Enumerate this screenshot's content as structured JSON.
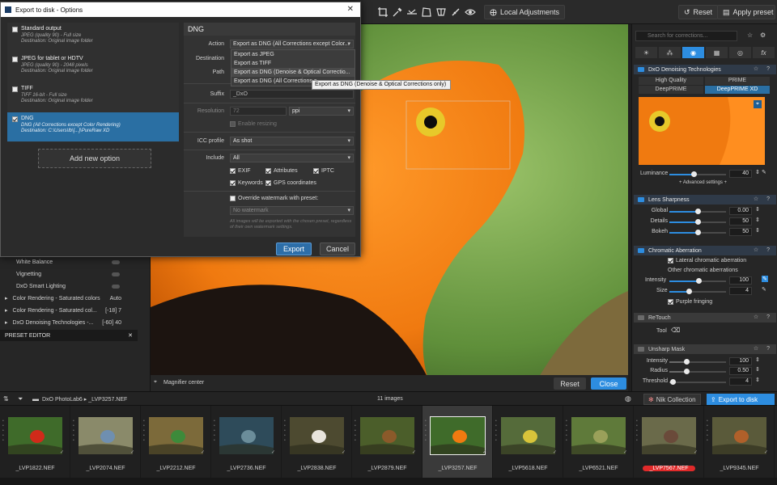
{
  "toolbar": {
    "local_adjustments": "Local Adjustments",
    "reset": "Reset",
    "apply_preset": "Apply preset"
  },
  "viewer": {
    "magnifier_center": "Magnifier center",
    "reset": "Reset",
    "close": "Close"
  },
  "left_panel": {
    "rows": [
      {
        "label": "White Balance",
        "value": ""
      },
      {
        "label": "Vignetting",
        "value": ""
      },
      {
        "label": "DxO Smart Lighting",
        "value": ""
      },
      {
        "label": "Color Rendering - Saturated colors",
        "value": "Auto"
      },
      {
        "label": "Color Rendering - Saturated col...",
        "value": "[-18]  7"
      },
      {
        "label": "DxO Denoising Technologies -...",
        "value": "[-60]  40"
      }
    ],
    "preset_editor": "PRESET EDITOR"
  },
  "right_panel": {
    "search_placeholder": "Search for corrections...",
    "denoise": {
      "title": "DxO Denoising Technologies",
      "modes": [
        "High Quality",
        "PRIME",
        "DeepPRIME",
        "DeepPRIME XD"
      ],
      "luminance_label": "Luminance",
      "luminance_value": "40",
      "advanced": "+ Advanced settings +"
    },
    "lens_sharpness": {
      "title": "Lens Sharpness",
      "rows": [
        {
          "label": "Global",
          "value": "0.00",
          "fraction": 0.5
        },
        {
          "label": "Details",
          "value": "50",
          "fraction": 0.5
        },
        {
          "label": "Bokeh",
          "value": "50",
          "fraction": 0.5
        }
      ]
    },
    "chromatic": {
      "title": "Chromatic Aberration",
      "lateral": "Lateral chromatic aberration",
      "other": "Other chromatic aberrations",
      "intensity_label": "Intensity",
      "intensity_value": "100",
      "size_label": "Size",
      "size_value": "4",
      "purple": "Purple fringing"
    },
    "retouch": {
      "title": "ReTouch",
      "tool": "Tool"
    },
    "unsharp": {
      "title": "Unsharp Mask",
      "rows": [
        {
          "label": "Intensity",
          "value": "100"
        },
        {
          "label": "Radius",
          "value": "0.50"
        },
        {
          "label": "Threshold",
          "value": "4"
        }
      ]
    }
  },
  "filmbar": {
    "path": "DxO PhotoLab6  ▸  _LVP3257.NEF",
    "count": "11 images",
    "nik": "Nik Collection",
    "export": "Export to disk"
  },
  "filmstrip": {
    "items": [
      "_LVP1822.NEF",
      "_LVP2074.NEF",
      "_LVP2212.NEF",
      "_LVP2736.NEF",
      "_LVP2838.NEF",
      "_LVP2879.NEF",
      "_LVP3257.NEF",
      "_LVP5618.NEF",
      "_LVP6521.NEF",
      "_LVP7567.NEF",
      "_LVP9345.NEF"
    ]
  },
  "dialog": {
    "title": "Export to disk - Options",
    "options": [
      {
        "title": "Standard output",
        "line1": "JPEG (quality 90) - Full size",
        "line2": "Destination: Original image folder"
      },
      {
        "title": "JPEG for tablet or HDTV",
        "line1": "JPEG (quality 90) - 2048 pixels",
        "line2": "Destination: Original image folder"
      },
      {
        "title": "TIFF",
        "line1": "TIFF 16-bit - Full size",
        "line2": "Destination: Original image folder"
      },
      {
        "title": "DNG",
        "line1": "DNG (All Corrections except Color Rendering)",
        "line2": "Destination: C:\\Users\\lb\\[...]\\PureRaw XD"
      }
    ],
    "add_option": "Add new option",
    "section_title": "DNG",
    "labels": {
      "action": "Action",
      "destination": "Destination",
      "path": "Path",
      "suffix": "Suffix",
      "resolution": "Resolution",
      "icc": "ICC profile",
      "include": "Include"
    },
    "action_value": "Export as DNG (All Corrections except Color...",
    "menu": [
      "Export as JPEG",
      "Export as TIFF",
      "Export as DNG (Denoise & Optical Correctio...",
      "Export as DNG (All Corrections e"
    ],
    "tooltip": "Export as DNG (Denoise & Optical Corrections only)",
    "suffix_value": "_DxO",
    "resolution_value": "72",
    "resolution_unit": "ppi",
    "enable_resizing": "Enable resizing",
    "icc_value": "As shot",
    "include_value": "All",
    "checks": [
      "EXIF",
      "Attributes",
      "IPTC",
      "Keywords",
      "GPS coordinates"
    ],
    "override": "Override watermark with preset:",
    "watermark": "No watermark",
    "note": "All images will be exported with the chosen preset, regardless of their own watermark settings.",
    "export": "Export",
    "cancel": "Cancel"
  },
  "colors": {
    "accent": "#2d8de0",
    "selected": "#2a6fa3",
    "bird_orange": "#f07a10"
  }
}
